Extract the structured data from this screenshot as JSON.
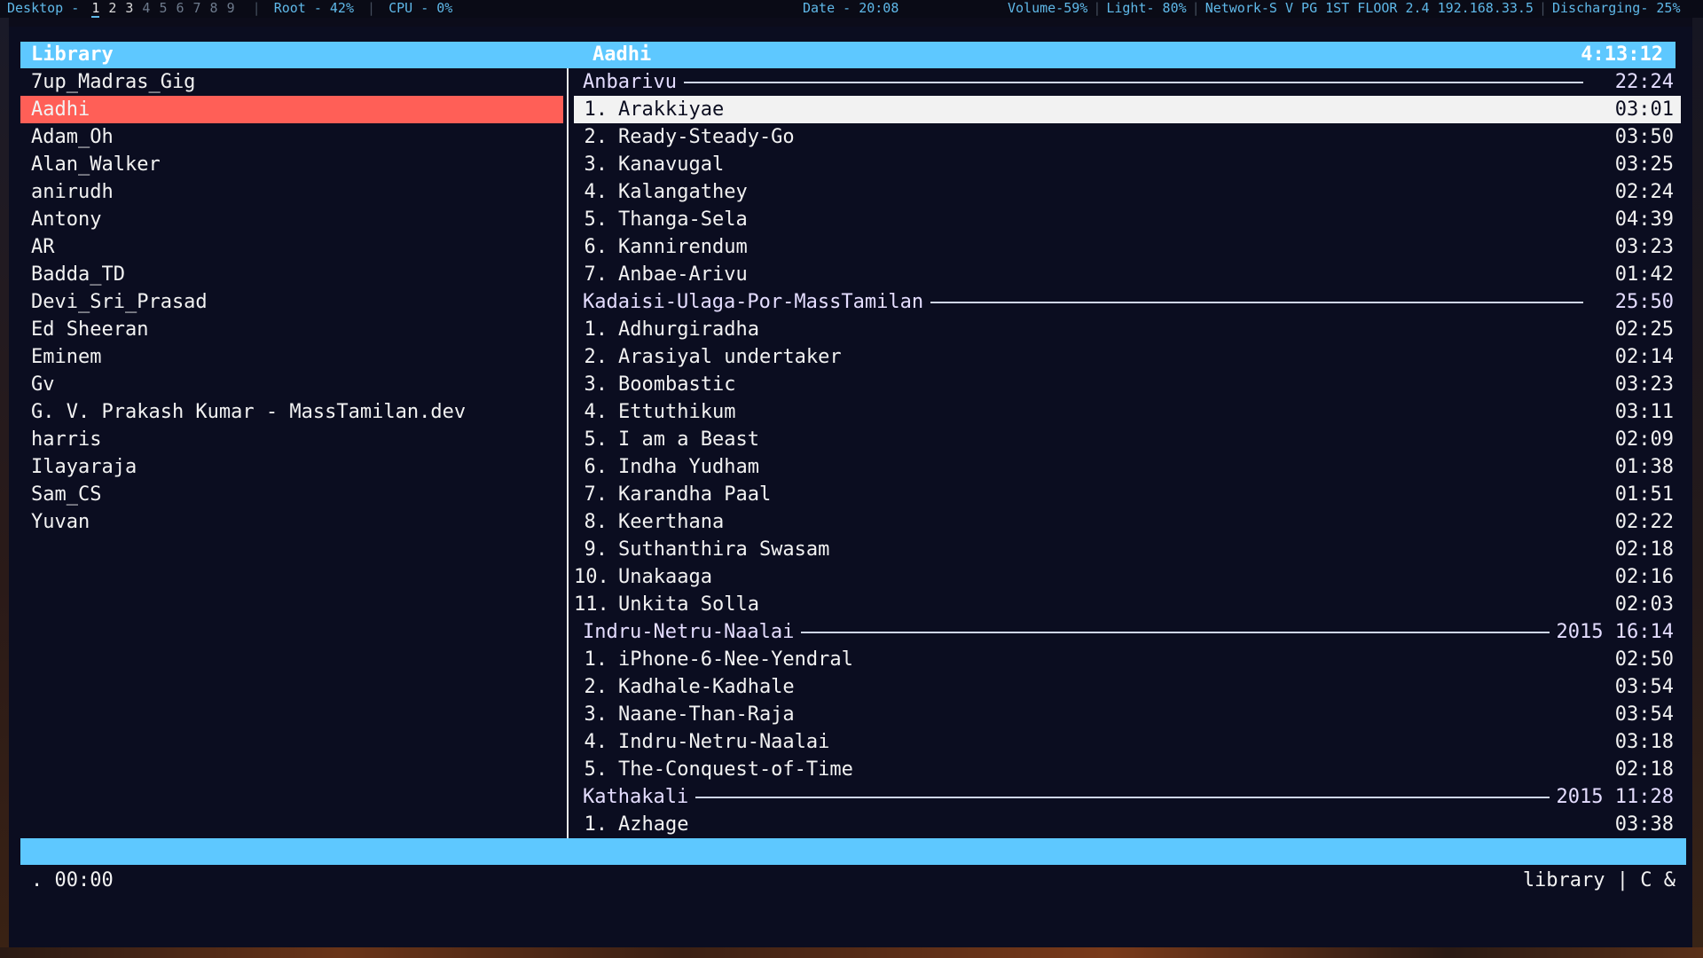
{
  "topbar": {
    "desktop_label": "Desktop -",
    "workspaces": [
      "1",
      "2",
      "3",
      "4",
      "5",
      "6",
      "7",
      "8",
      "9"
    ],
    "active_workspace": "1",
    "root": "Root - 42%",
    "cpu": "CPU - 0%",
    "date": "Date - 20:08",
    "volume": "Volume-59%",
    "light": "Light- 80%",
    "network": "Network-S V PG 1ST FLOOR 2.4 192.168.33.5",
    "battery": "Discharging- 25%"
  },
  "library": {
    "header": "Library",
    "items": [
      "7up_Madras_Gig",
      "Aadhi",
      "Adam_Oh",
      "Alan_Walker",
      "anirudh",
      "Antony",
      "AR",
      "Badda_TD",
      "Devi_Sri_Prasad",
      "Ed Sheeran",
      "Eminem",
      "Gv",
      "G. V. Prakash Kumar - MassTamilan.dev",
      "harris",
      "Ilayaraja",
      "Sam_CS",
      "Yuvan"
    ],
    "selected_index": 1
  },
  "playlist": {
    "title": "Aadhi",
    "total_duration": "4:13:12",
    "albums": [
      {
        "name": "Anbarivu",
        "year": "",
        "duration": "22:24",
        "tracks": [
          {
            "n": "1.",
            "title": "Arakkiyae",
            "time": "03:01"
          },
          {
            "n": "2.",
            "title": "Ready-Steady-Go",
            "time": "03:50"
          },
          {
            "n": "3.",
            "title": "Kanavugal",
            "time": "03:25"
          },
          {
            "n": "4.",
            "title": "Kalangathey",
            "time": "02:24"
          },
          {
            "n": "5.",
            "title": "Thanga-Sela",
            "time": "04:39"
          },
          {
            "n": "6.",
            "title": "Kannirendum",
            "time": "03:23"
          },
          {
            "n": "7.",
            "title": "Anbae-Arivu",
            "time": "01:42"
          }
        ]
      },
      {
        "name": "Kadaisi-Ulaga-Por-MassTamilan",
        "year": "",
        "duration": "25:50",
        "tracks": [
          {
            "n": "1.",
            "title": "Adhurgiradha",
            "time": "02:25"
          },
          {
            "n": "2.",
            "title": "Arasiyal undertaker",
            "time": "02:14"
          },
          {
            "n": "3.",
            "title": "Boombastic",
            "time": "03:23"
          },
          {
            "n": "4.",
            "title": "Ettuthikum",
            "time": "03:11"
          },
          {
            "n": "5.",
            "title": "I am a Beast",
            "time": "02:09"
          },
          {
            "n": "6.",
            "title": "Indha Yudham",
            "time": "01:38"
          },
          {
            "n": "7.",
            "title": "Karandha Paal",
            "time": "01:51"
          },
          {
            "n": "8.",
            "title": "Keerthana",
            "time": "02:22"
          },
          {
            "n": "9.",
            "title": "Suthanthira Swasam",
            "time": "02:18"
          },
          {
            "n": "10.",
            "title": "Unakaaga",
            "time": "02:16"
          },
          {
            "n": "11.",
            "title": "Unkita Solla",
            "time": "02:03"
          }
        ]
      },
      {
        "name": "Indru-Netru-Naalai",
        "year": "2015",
        "duration": "16:14",
        "tracks": [
          {
            "n": "1.",
            "title": "iPhone-6-Nee-Yendral",
            "time": "02:50"
          },
          {
            "n": "2.",
            "title": "Kadhale-Kadhale",
            "time": "03:54"
          },
          {
            "n": "3.",
            "title": "Naane-Than-Raja",
            "time": "03:54"
          },
          {
            "n": "4.",
            "title": "Indru-Netru-Naalai",
            "time": "03:18"
          },
          {
            "n": "5.",
            "title": "The-Conquest-of-Time",
            "time": "02:18"
          }
        ]
      },
      {
        "name": "Kathakali",
        "year": "2015",
        "duration": "11:28",
        "tracks": [
          {
            "n": "1.",
            "title": "Azhage",
            "time": "03:38"
          }
        ]
      }
    ],
    "current": {
      "album": 0,
      "track": 0
    }
  },
  "cmdline": {
    "position": ". 00:00",
    "right": "library | C  &"
  }
}
